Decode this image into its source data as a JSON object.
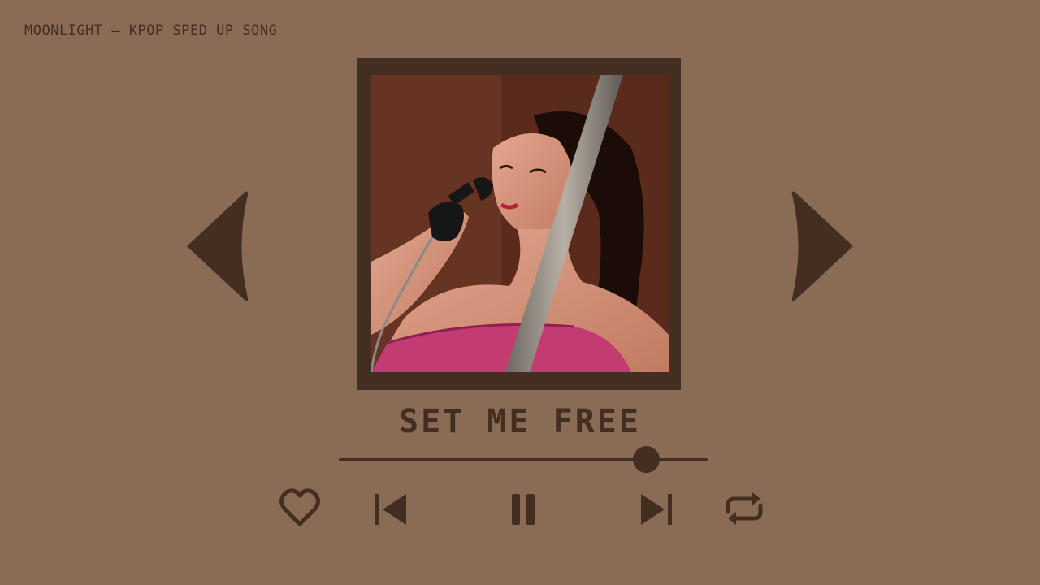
{
  "header": {
    "title": "MOONLIGHT — KPOP SPED UP SONG"
  },
  "album_art": {
    "description_icon": "photo"
  },
  "song": {
    "title": "SET ME FREE"
  },
  "progress": {
    "fraction": 0.833
  },
  "controls": {
    "icons": [
      "heart-icon",
      "skip-back-icon",
      "pause-icon",
      "skip-forward-icon",
      "repeat-icon"
    ]
  },
  "colors": {
    "background": "#8a6b55",
    "accent": "#432e21"
  }
}
